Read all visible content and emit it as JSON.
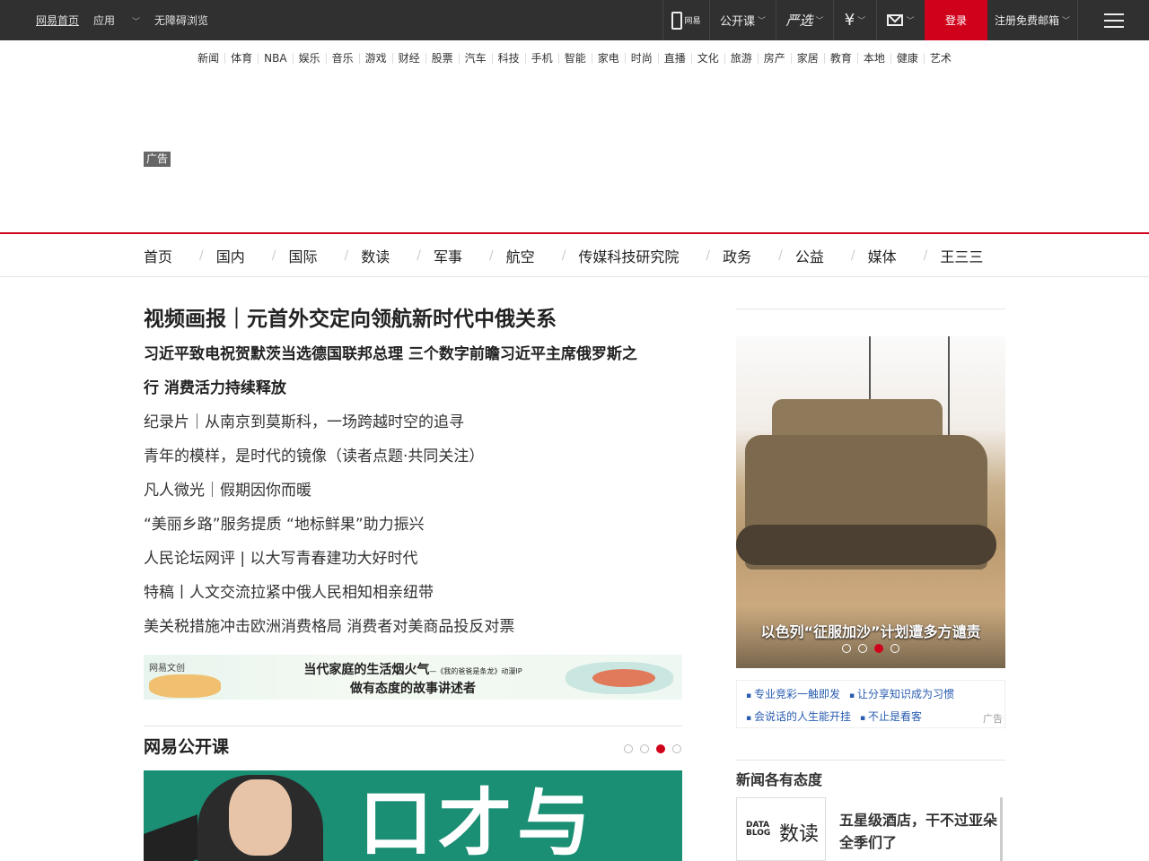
{
  "topbar": {
    "left_links": [
      "网易首页",
      "应用",
      "无障碍浏览"
    ],
    "app_icon_label": "网易",
    "open_course": "公开课",
    "yanxuan": "严选",
    "money_icon": "yen-icon",
    "mail_icon": "mail-icon",
    "login": "登录",
    "register": "注册免费邮箱"
  },
  "channel_nav": [
    "新闻",
    "体育",
    "NBA",
    "娱乐",
    "音乐",
    "游戏",
    "财经",
    "股票",
    "汽车",
    "科技",
    "手机",
    "智能",
    "家电",
    "时尚",
    "直播",
    "文化",
    "旅游",
    "房产",
    "家居",
    "教育",
    "本地",
    "健康",
    "艺术"
  ],
  "ad_label": "广告",
  "section_nav": [
    "首页",
    "国内",
    "国际",
    "数读",
    "军事",
    "航空",
    "传媒科技研究院",
    "政务",
    "公益",
    "媒体",
    "王三三"
  ],
  "headlines": {
    "top": "视频画报｜元首外交定向领航新时代中俄关系",
    "bold_line1": "习近平致电祝贺默茨当选德国联邦总理   三个数字前瞻习近平主席俄罗斯之",
    "bold_line2": "行   消费活力持续释放",
    "items": [
      "纪录片｜从南京到莫斯科，一场跨越时空的追寻",
      "青年的模样，是时代的镜像（读者点题·共同关注）",
      "凡人微光｜假期因你而暖",
      "“美丽乡路”服务提质 “地标鲜果”助力振兴",
      "人民论坛网评 | 以大写青春建功大好时代",
      "特稿丨人文交流拉紧中俄人民相知相亲纽带",
      "美关税措施冲击欧洲消费格局 消费者对美商品投反对票"
    ]
  },
  "banner": {
    "logo": "网易文创",
    "line1": "当代家庭的生活烟火气",
    "line1_sub": "—《我的爸爸是条龙》动漫IP",
    "line2": "做有态度的故事讲述者"
  },
  "open_course": {
    "title": "网易公开课",
    "image_text": "口才与",
    "active_dot": 2
  },
  "slideshow": {
    "caption": "以色列“征服加沙”计划遭多方谴责",
    "active_dot": 2
  },
  "ad_links": {
    "row1": [
      "专业竞彩一触即发",
      "让分享知识成为习惯"
    ],
    "row2": [
      "会说话的人生能开挂",
      "不止是看客"
    ],
    "ad": "广告"
  },
  "attitude": {
    "title": "新闻各有态度",
    "card_logo": "DATA BLOG",
    "card_name": "数读",
    "headline": "五星级酒店，干不过亚朵全季们了"
  },
  "colors": {
    "accent": "#d0021b",
    "topbar": "#303030",
    "link": "#2a5db0"
  }
}
